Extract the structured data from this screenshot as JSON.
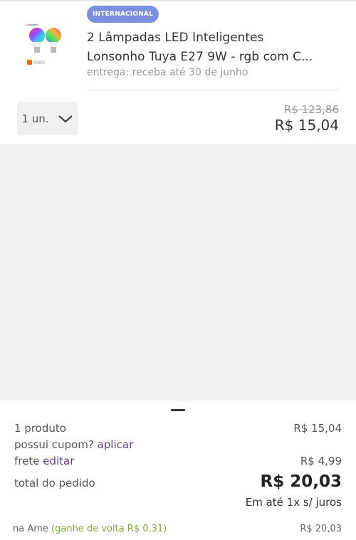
{
  "product": {
    "badge": "INTERNACIONAL",
    "title_line1": "2 Lâmpadas LED Inteligentes",
    "title_line2": "Lonsonho Tuya E27 9W - rgb com C...",
    "delivery": "entrega: receba até 30 de junho",
    "quantity_label": "1 un.",
    "old_price": "R$ 123,86",
    "price": "R$ 15,04",
    "image_icon": "led-bulbs-product-image",
    "image_caption": "Lonsonho"
  },
  "summary": {
    "products_label": "1 produto",
    "products_value": "R$ 15,04",
    "coupon_label": "possui cupom?",
    "coupon_link": "aplicar",
    "shipping_label": "frete",
    "shipping_link": "editar",
    "shipping_value": "R$ 4,99",
    "total_label": "total do pedido",
    "total_value": "R$ 20,03",
    "installments": "Em até 1x s/ juros",
    "ame_label": "na Ame",
    "ame_cashback": "(ganhe de volta R$ 0,31)",
    "ame_value": "R$ 20,03"
  },
  "colors": {
    "badge": "#7b8fe0",
    "link": "#6a3a8c",
    "cashback": "#7fae2c",
    "background": "#f0f0f0"
  }
}
